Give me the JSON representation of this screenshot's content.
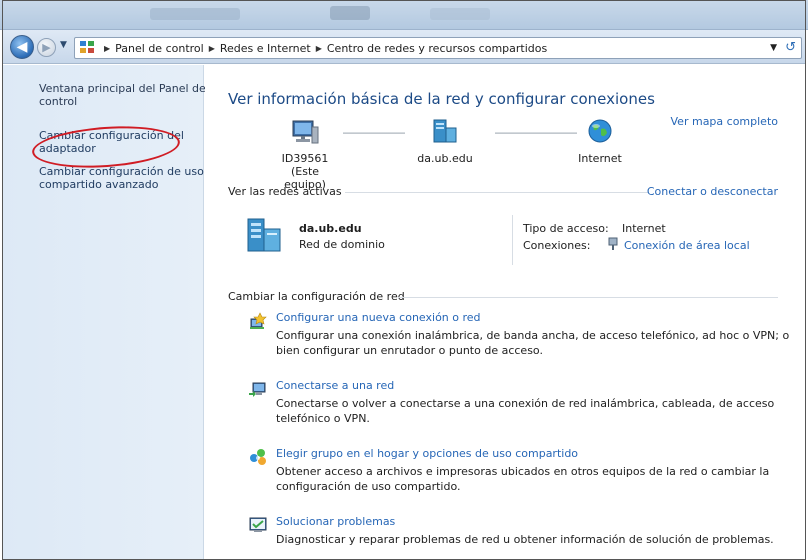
{
  "toolbar": {
    "breadcrumbs": [
      "Panel de control",
      "Redes e Internet",
      "Centro de redes y recursos compartidos"
    ]
  },
  "left_pane": {
    "links": [
      "Ventana principal del Panel de control",
      "Cambiar configuración del adaptador",
      "Cambiar configuración de uso compartido avanzado"
    ]
  },
  "main": {
    "title": "Ver información básica de la red y configurar conexiones",
    "full_map_link": "Ver mapa completo",
    "map": {
      "computer_name": "ID39561",
      "computer_sub": "(Este equipo)",
      "network_name": "da.ub.edu",
      "internet_label": "Internet"
    },
    "active_networks": {
      "heading": "Ver las redes activas",
      "connect_link": "Conectar o desconectar",
      "network_name": "da.ub.edu",
      "network_type": "Red de dominio",
      "access_type_label": "Tipo de acceso:",
      "access_type_value": "Internet",
      "connections_label": "Conexiones:",
      "connections_value": "Conexión de área local"
    },
    "change_settings": {
      "heading": "Cambiar la configuración de red",
      "tasks": [
        {
          "title": "Configurar una nueva conexión o red",
          "desc": "Configurar una conexión inalámbrica, de banda ancha, de acceso telefónico, ad hoc o VPN; o bien configurar un enrutador o punto de acceso."
        },
        {
          "title": "Conectarse a una red",
          "desc": "Conectarse o volver a conectarse a una conexión de red inalámbrica, cableada, de acceso telefónico o VPN."
        },
        {
          "title": "Elegir grupo en el hogar y opciones de uso compartido",
          "desc": "Obtener acceso a archivos e impresoras ubicados en otros equipos de la red o cambiar la configuración de uso compartido."
        },
        {
          "title": "Solucionar problemas",
          "desc": "Diagnosticar y reparar problemas de red u obtener información de solución de problemas."
        }
      ]
    }
  },
  "colors": {
    "link": "#2666b6",
    "title": "#1c4a86",
    "annotation_oval": "#d01c24"
  }
}
